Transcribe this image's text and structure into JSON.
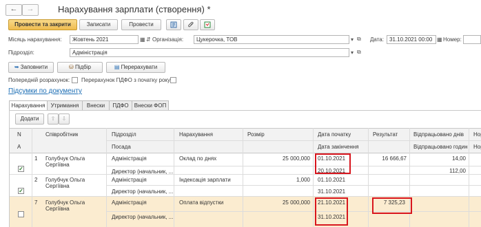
{
  "window": {
    "back": "←",
    "forward": "→",
    "title": "Нарахування зарплати (створення) *"
  },
  "toolbar": {
    "post_close": "Провести та закрити",
    "save": "Записати",
    "post": "Провести"
  },
  "form": {
    "month_label": "Місяць нарахування:",
    "month_value": "Жовтень 2021",
    "org_label": "Організація:",
    "org_value": "Цукерочка, ТОВ",
    "date_label": "Дата:",
    "date_value": "31.10.2021 00:00",
    "number_label": "Номер:",
    "number_value": "",
    "dept_label": "Підрозділ:",
    "dept_value": "Адміністрація"
  },
  "actions": {
    "fill": "Заповнити",
    "pick": "Підбір",
    "recalc": "Перерахувати"
  },
  "options": {
    "preliminary": "Попередній розрахунок:",
    "pdfo_recalc": "Перерахунок ПДФО з початку року:"
  },
  "totals_link": "Підсумки по документу",
  "tabs": [
    "Нарахування",
    "Утримання",
    "Внески",
    "ПДФО",
    "Внески ФОП"
  ],
  "grid_toolbar": {
    "add": "Додати",
    "up": "⇧",
    "down": "⇩"
  },
  "columns": {
    "n": "N",
    "a": "А",
    "employee": "Співробітник",
    "dept": "Підрозділ",
    "position": "Посада",
    "accrual": "Нарахування",
    "amount": "Розмір",
    "start": "Дата початку",
    "end": "Дата закінчення",
    "result": "Результат",
    "days": "Відпрацьовано днів",
    "hours": "Відпрацьовано годин",
    "norm1": "Нор",
    "norm2": "Нор"
  },
  "rows": [
    {
      "n": "1",
      "checked": true,
      "employee1": "Голубчук Ольга",
      "employee2": "Сергіївна",
      "dept": "Адміністрація",
      "position": "Директор (начальник, ...",
      "accrual": "Оклад по днях",
      "amount": "25 000,000",
      "start": "01.10.2021",
      "end": "20.10.2021",
      "result": "16 666,67",
      "days": "14,00",
      "hours": "112,00"
    },
    {
      "n": "2",
      "checked": true,
      "employee1": "Голубчук Ольга",
      "employee2": "Сергіївна",
      "dept": "Адміністрація",
      "position": "Директор (начальник, ...",
      "accrual": "Індексація зарплати",
      "amount": "1,000",
      "start": "01.10.2021",
      "end": "31.10.2021",
      "result": "",
      "days": "",
      "hours": ""
    },
    {
      "n": "7",
      "checked": false,
      "employee1": "Голубчук Ольга",
      "employee2": "Сергіївна",
      "dept": "Адміністрація",
      "position": "Директор (начальник, ...",
      "accrual": "Оплата відпустки",
      "amount": "25 000,000",
      "start": "21.10.2021",
      "end": "31.10.2021",
      "result": "7 325,23",
      "days": "",
      "hours": ""
    }
  ],
  "colors": {
    "accent_primary": "#efbc4f",
    "link": "#1a6db4",
    "highlight_row": "#fbecd0",
    "red_annotation": "#d8151d"
  }
}
